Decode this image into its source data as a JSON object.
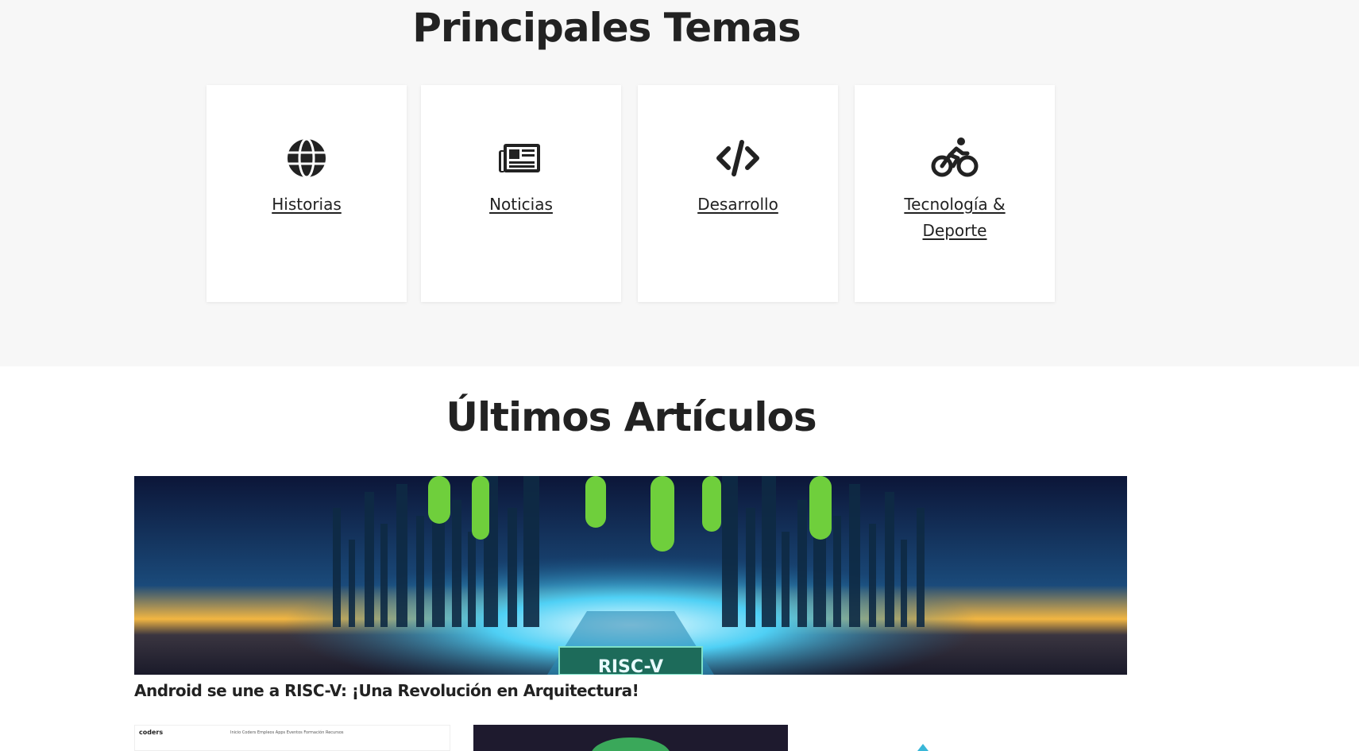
{
  "topics": {
    "title": "Principales Temas",
    "cards": [
      {
        "label": "Historias",
        "icon": "globe-icon"
      },
      {
        "label": "Noticias",
        "icon": "newspaper-icon"
      },
      {
        "label": "Desarrollo",
        "icon": "code-icon"
      },
      {
        "label": "Tecnología & Deporte",
        "icon": "cyclist-icon"
      }
    ]
  },
  "articles": {
    "title": "Últimos Artículos",
    "featured": {
      "title": "Android se une a RISC-V: ¡Una Revolución en Arquitectura!",
      "image_text": "RISC-V"
    },
    "thumbnails": [
      {
        "logo": "coders",
        "nav": "Inicio  Coders  Empleos  Apps  Eventos  Formación  Recursos"
      },
      {
        "logo": ""
      },
      {
        "logo": ""
      }
    ]
  },
  "colors": {
    "section_bg": "#f7f7f7",
    "card_bg": "#ffffff",
    "text": "#222222"
  }
}
